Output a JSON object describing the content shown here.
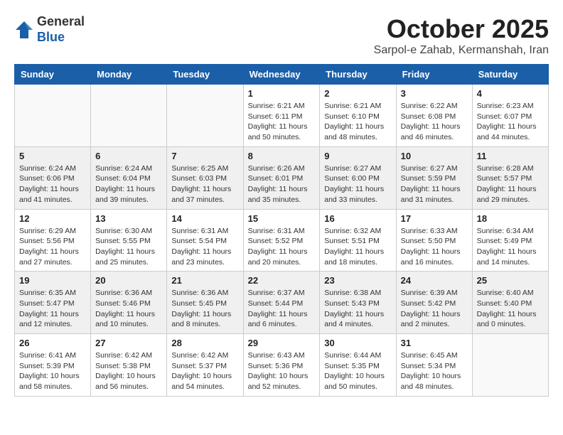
{
  "header": {
    "logo_general": "General",
    "logo_blue": "Blue",
    "month": "October 2025",
    "location": "Sarpol-e Zahab, Kermanshah, Iran"
  },
  "days_of_week": [
    "Sunday",
    "Monday",
    "Tuesday",
    "Wednesday",
    "Thursday",
    "Friday",
    "Saturday"
  ],
  "weeks": [
    [
      {
        "day": "",
        "info": ""
      },
      {
        "day": "",
        "info": ""
      },
      {
        "day": "",
        "info": ""
      },
      {
        "day": "1",
        "info": "Sunrise: 6:21 AM\nSunset: 6:11 PM\nDaylight: 11 hours\nand 50 minutes."
      },
      {
        "day": "2",
        "info": "Sunrise: 6:21 AM\nSunset: 6:10 PM\nDaylight: 11 hours\nand 48 minutes."
      },
      {
        "day": "3",
        "info": "Sunrise: 6:22 AM\nSunset: 6:08 PM\nDaylight: 11 hours\nand 46 minutes."
      },
      {
        "day": "4",
        "info": "Sunrise: 6:23 AM\nSunset: 6:07 PM\nDaylight: 11 hours\nand 44 minutes."
      }
    ],
    [
      {
        "day": "5",
        "info": "Sunrise: 6:24 AM\nSunset: 6:06 PM\nDaylight: 11 hours\nand 41 minutes."
      },
      {
        "day": "6",
        "info": "Sunrise: 6:24 AM\nSunset: 6:04 PM\nDaylight: 11 hours\nand 39 minutes."
      },
      {
        "day": "7",
        "info": "Sunrise: 6:25 AM\nSunset: 6:03 PM\nDaylight: 11 hours\nand 37 minutes."
      },
      {
        "day": "8",
        "info": "Sunrise: 6:26 AM\nSunset: 6:01 PM\nDaylight: 11 hours\nand 35 minutes."
      },
      {
        "day": "9",
        "info": "Sunrise: 6:27 AM\nSunset: 6:00 PM\nDaylight: 11 hours\nand 33 minutes."
      },
      {
        "day": "10",
        "info": "Sunrise: 6:27 AM\nSunset: 5:59 PM\nDaylight: 11 hours\nand 31 minutes."
      },
      {
        "day": "11",
        "info": "Sunrise: 6:28 AM\nSunset: 5:57 PM\nDaylight: 11 hours\nand 29 minutes."
      }
    ],
    [
      {
        "day": "12",
        "info": "Sunrise: 6:29 AM\nSunset: 5:56 PM\nDaylight: 11 hours\nand 27 minutes."
      },
      {
        "day": "13",
        "info": "Sunrise: 6:30 AM\nSunset: 5:55 PM\nDaylight: 11 hours\nand 25 minutes."
      },
      {
        "day": "14",
        "info": "Sunrise: 6:31 AM\nSunset: 5:54 PM\nDaylight: 11 hours\nand 23 minutes."
      },
      {
        "day": "15",
        "info": "Sunrise: 6:31 AM\nSunset: 5:52 PM\nDaylight: 11 hours\nand 20 minutes."
      },
      {
        "day": "16",
        "info": "Sunrise: 6:32 AM\nSunset: 5:51 PM\nDaylight: 11 hours\nand 18 minutes."
      },
      {
        "day": "17",
        "info": "Sunrise: 6:33 AM\nSunset: 5:50 PM\nDaylight: 11 hours\nand 16 minutes."
      },
      {
        "day": "18",
        "info": "Sunrise: 6:34 AM\nSunset: 5:49 PM\nDaylight: 11 hours\nand 14 minutes."
      }
    ],
    [
      {
        "day": "19",
        "info": "Sunrise: 6:35 AM\nSunset: 5:47 PM\nDaylight: 11 hours\nand 12 minutes."
      },
      {
        "day": "20",
        "info": "Sunrise: 6:36 AM\nSunset: 5:46 PM\nDaylight: 11 hours\nand 10 minutes."
      },
      {
        "day": "21",
        "info": "Sunrise: 6:36 AM\nSunset: 5:45 PM\nDaylight: 11 hours\nand 8 minutes."
      },
      {
        "day": "22",
        "info": "Sunrise: 6:37 AM\nSunset: 5:44 PM\nDaylight: 11 hours\nand 6 minutes."
      },
      {
        "day": "23",
        "info": "Sunrise: 6:38 AM\nSunset: 5:43 PM\nDaylight: 11 hours\nand 4 minutes."
      },
      {
        "day": "24",
        "info": "Sunrise: 6:39 AM\nSunset: 5:42 PM\nDaylight: 11 hours\nand 2 minutes."
      },
      {
        "day": "25",
        "info": "Sunrise: 6:40 AM\nSunset: 5:40 PM\nDaylight: 11 hours\nand 0 minutes."
      }
    ],
    [
      {
        "day": "26",
        "info": "Sunrise: 6:41 AM\nSunset: 5:39 PM\nDaylight: 10 hours\nand 58 minutes."
      },
      {
        "day": "27",
        "info": "Sunrise: 6:42 AM\nSunset: 5:38 PM\nDaylight: 10 hours\nand 56 minutes."
      },
      {
        "day": "28",
        "info": "Sunrise: 6:42 AM\nSunset: 5:37 PM\nDaylight: 10 hours\nand 54 minutes."
      },
      {
        "day": "29",
        "info": "Sunrise: 6:43 AM\nSunset: 5:36 PM\nDaylight: 10 hours\nand 52 minutes."
      },
      {
        "day": "30",
        "info": "Sunrise: 6:44 AM\nSunset: 5:35 PM\nDaylight: 10 hours\nand 50 minutes."
      },
      {
        "day": "31",
        "info": "Sunrise: 6:45 AM\nSunset: 5:34 PM\nDaylight: 10 hours\nand 48 minutes."
      },
      {
        "day": "",
        "info": ""
      }
    ]
  ]
}
